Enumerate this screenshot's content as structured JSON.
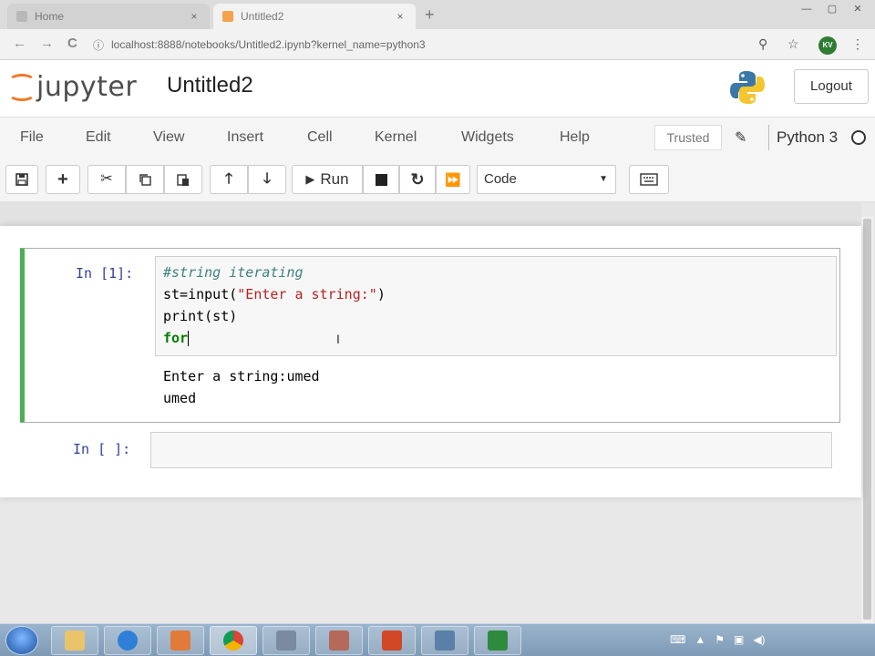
{
  "browser": {
    "tabs": [
      {
        "title": "Home",
        "close": "×"
      },
      {
        "title": "Untitled2",
        "close": "×"
      }
    ],
    "new_tab": "+",
    "window_buttons": [
      "—",
      "▢",
      "✕"
    ],
    "back": "←",
    "forward": "→",
    "reload": "C",
    "url": "localhost:8888/notebooks/Untitled2.ipynb?kernel_name=python3",
    "avatar": "KV"
  },
  "jupyter": {
    "logo_text": "jupyter",
    "notebook_title": "Untitled2",
    "logout_label": "Logout",
    "menu": [
      "File",
      "Edit",
      "View",
      "Insert",
      "Cell",
      "Kernel",
      "Widgets",
      "Help"
    ],
    "trusted_label": "Trusted",
    "kernel_name": "Python 3",
    "toolbar": {
      "run_label": "Run",
      "cell_type": "Code",
      "icons": [
        "save-icon",
        "plus-icon",
        "cut-icon",
        "copy-icon",
        "paste-icon",
        "arrow-up-icon",
        "arrow-down-icon",
        "run-icon",
        "stop-icon",
        "restart-icon",
        "fast-forward-icon",
        "keyboard-icon"
      ]
    }
  },
  "cells": [
    {
      "prompt": "In [1]:",
      "code": {
        "line1": "#string iterating",
        "line2_prefix": "st=input(",
        "line2_string": "\"Enter a string:\"",
        "line2_suffix": ")",
        "line3": "print(st)",
        "line4": "for"
      },
      "output": [
        "Enter a string:umed",
        "umed"
      ]
    },
    {
      "prompt": "In [ ]:",
      "code": ""
    }
  ],
  "colors": {
    "selected_cell_bar": "#4caf50",
    "prompt_blue": "#303f9f",
    "jupyter_orange": "#f37726",
    "keyword_green": "#008000",
    "string_red": "#ba2121",
    "comment_teal": "#408080"
  }
}
